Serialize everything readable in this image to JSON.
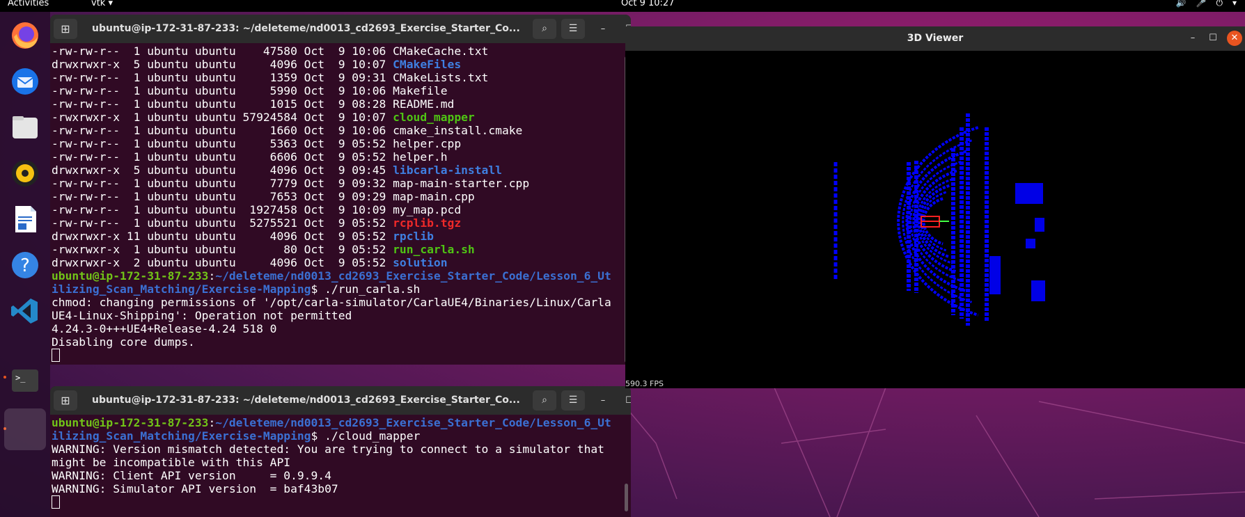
{
  "topbar": {
    "activities": "Activities",
    "app_menu": "vtk ▾",
    "clock": "Oct 9  10:27",
    "tray": [
      "🔊",
      "🎤",
      "⏻",
      "▾"
    ]
  },
  "dock": {
    "items": [
      "firefox-icon",
      "thunderbird-icon",
      "files-icon",
      "rhythmbox-icon",
      "writer-icon",
      "help-icon",
      "vscode-icon",
      "terminal-icon",
      "app-grid-icon"
    ]
  },
  "terminal1": {
    "title": "ubuntu@ip-172-31-87-233: ~/deleteme/nd0013_cd2693_Exercise_Starter_Co...",
    "listing": [
      {
        "perm": "-rw-rw-r--  1 ubuntu ubuntu    47580 Oct  9 10:06 ",
        "name": "CMakeCache.txt",
        "color": ""
      },
      {
        "perm": "drwxrwxr-x  5 ubuntu ubuntu     4096 Oct  9 10:07 ",
        "name": "CMakeFiles",
        "color": "c-blue"
      },
      {
        "perm": "-rw-rw-r--  1 ubuntu ubuntu     1359 Oct  9 09:31 ",
        "name": "CMakeLists.txt",
        "color": ""
      },
      {
        "perm": "-rw-rw-r--  1 ubuntu ubuntu     5990 Oct  9 10:06 ",
        "name": "Makefile",
        "color": ""
      },
      {
        "perm": "-rw-rw-r--  1 ubuntu ubuntu     1015 Oct  9 08:28 ",
        "name": "README.md",
        "color": ""
      },
      {
        "perm": "-rwxrwxr-x  1 ubuntu ubuntu 57924584 Oct  9 10:07 ",
        "name": "cloud_mapper",
        "color": "c-green"
      },
      {
        "perm": "-rw-rw-r--  1 ubuntu ubuntu     1660 Oct  9 10:06 ",
        "name": "cmake_install.cmake",
        "color": ""
      },
      {
        "perm": "-rw-rw-r--  1 ubuntu ubuntu     5363 Oct  9 05:52 ",
        "name": "helper.cpp",
        "color": ""
      },
      {
        "perm": "-rw-rw-r--  1 ubuntu ubuntu     6606 Oct  9 05:52 ",
        "name": "helper.h",
        "color": ""
      },
      {
        "perm": "drwxrwxr-x  5 ubuntu ubuntu     4096 Oct  9 09:45 ",
        "name": "libcarla-install",
        "color": "c-blue"
      },
      {
        "perm": "-rw-rw-r--  1 ubuntu ubuntu     7779 Oct  9 09:32 ",
        "name": "map-main-starter.cpp",
        "color": ""
      },
      {
        "perm": "-rw-rw-r--  1 ubuntu ubuntu     7653 Oct  9 09:29 ",
        "name": "map-main.cpp",
        "color": ""
      },
      {
        "perm": "-rw-rw-r--  1 ubuntu ubuntu  1927458 Oct  9 10:09 ",
        "name": "my_map.pcd",
        "color": ""
      },
      {
        "perm": "-rw-rw-r--  1 ubuntu ubuntu  5275521 Oct  9 05:52 ",
        "name": "rcplib.tgz",
        "color": "c-red"
      },
      {
        "perm": "drwxrwxr-x 11 ubuntu ubuntu     4096 Oct  9 05:52 ",
        "name": "rpclib",
        "color": "c-blue"
      },
      {
        "perm": "-rwxrwxr-x  1 ubuntu ubuntu       80 Oct  9 05:52 ",
        "name": "run_carla.sh",
        "color": "c-green"
      },
      {
        "perm": "drwxrwxr-x  2 ubuntu ubuntu     4096 Oct  9 05:52 ",
        "name": "solution",
        "color": "c-blue"
      }
    ],
    "prompt_user": "ubuntu@ip-172-31-87-233",
    "prompt_path_1": "~/deleteme/nd0013_cd2693_Exercise_Starter_Code/Lesson_6_Ut",
    "prompt_path_2": "ilizing_Scan_Matching/Exercise-Mapping",
    "command": "$ ./run_carla.sh",
    "output": [
      "chmod: changing permissions of '/opt/carla-simulator/CarlaUE4/Binaries/Linux/Carla",
      "UE4-Linux-Shipping': Operation not permitted",
      "4.24.3-0+++UE4+Release-4.24 518 0",
      "Disabling core dumps."
    ]
  },
  "terminal2": {
    "title": "ubuntu@ip-172-31-87-233: ~/deleteme/nd0013_cd2693_Exercise_Starter_Co...",
    "prompt_user": "ubuntu@ip-172-31-87-233",
    "prompt_path_1": "~/deleteme/nd0013_cd2693_Exercise_Starter_Code/Lesson_6_Ut",
    "prompt_path_2": "ilizing_Scan_Matching/Exercise-Mapping",
    "command": "$ ./cloud_mapper",
    "output": [
      "WARNING: Version mismatch detected: You are trying to connect to a simulator that",
      "might be incompatible with this API",
      "WARNING: Client API version     = 0.9.9.4",
      "WARNING: Simulator API version  = baf43b07"
    ]
  },
  "viewer": {
    "title": "3D Viewer",
    "fps": "590.3 FPS",
    "point_color": "#0000ff",
    "car_color": "#ff2020"
  }
}
